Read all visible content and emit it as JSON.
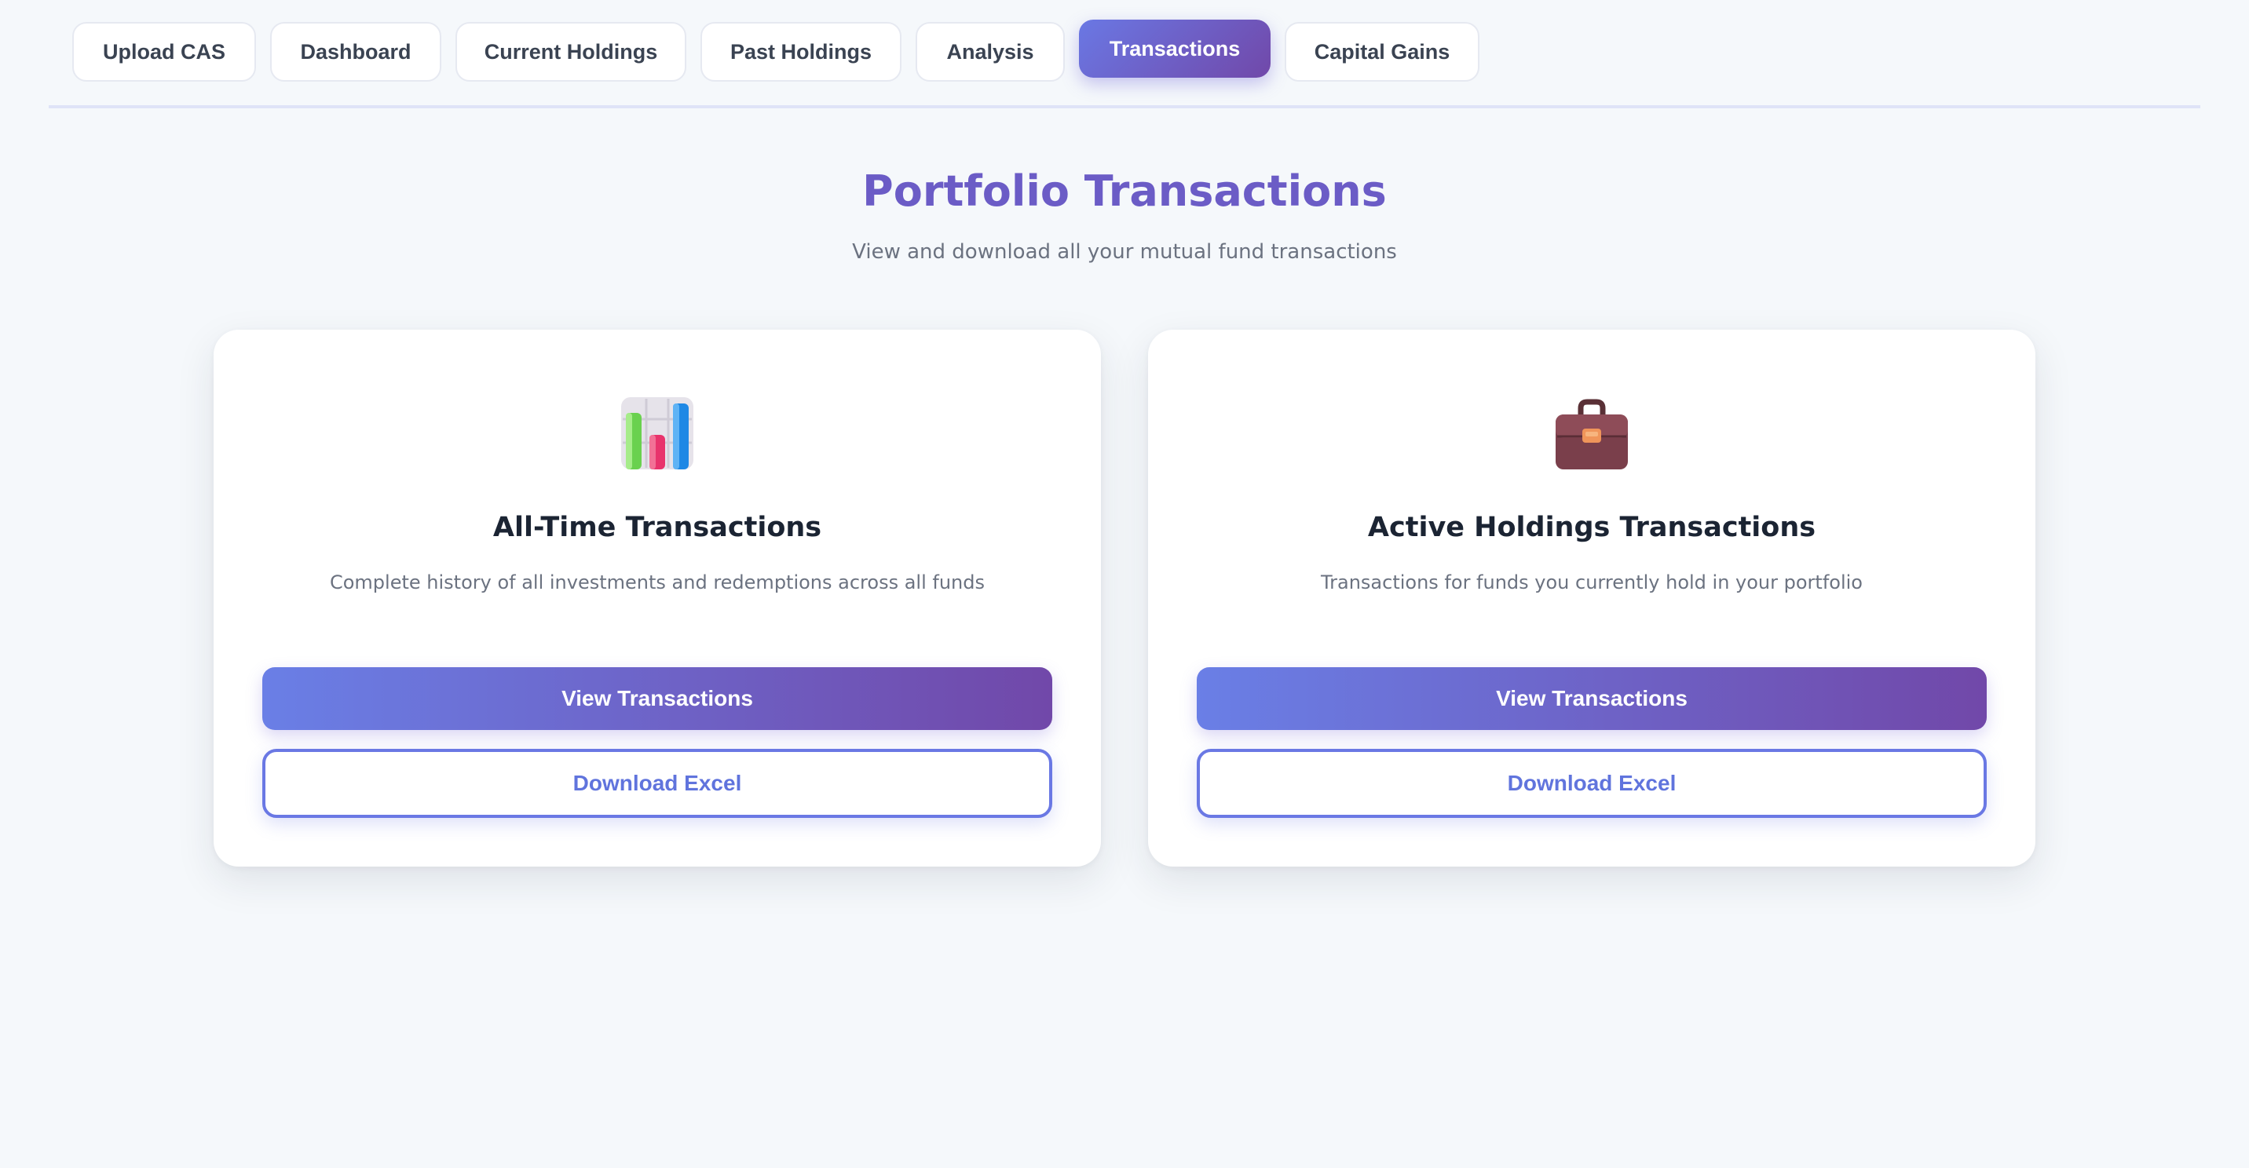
{
  "nav": {
    "tabs": [
      {
        "label": "Upload CAS",
        "active": false
      },
      {
        "label": "Dashboard",
        "active": false
      },
      {
        "label": "Current Holdings",
        "active": false
      },
      {
        "label": "Past Holdings",
        "active": false
      },
      {
        "label": "Analysis",
        "active": false
      },
      {
        "label": "Transactions",
        "active": true
      },
      {
        "label": "Capital Gains",
        "active": false
      }
    ]
  },
  "header": {
    "title": "Portfolio Transactions",
    "subtitle": "View and download all your mutual fund transactions"
  },
  "cards": [
    {
      "icon": "bar-chart-icon",
      "title": "All-Time Transactions",
      "description": "Complete history of all investments and redemptions across all funds",
      "view_label": "View Transactions",
      "download_label": "Download Excel"
    },
    {
      "icon": "briefcase-icon",
      "title": "Active Holdings Transactions",
      "description": "Transactions for funds you currently hold in your portfolio",
      "view_label": "View Transactions",
      "download_label": "Download Excel"
    }
  ],
  "colors": {
    "accent_start": "#6a78e4",
    "accent_end": "#7148a9",
    "title": "#6b5cc6",
    "background": "#f5f8fb"
  }
}
